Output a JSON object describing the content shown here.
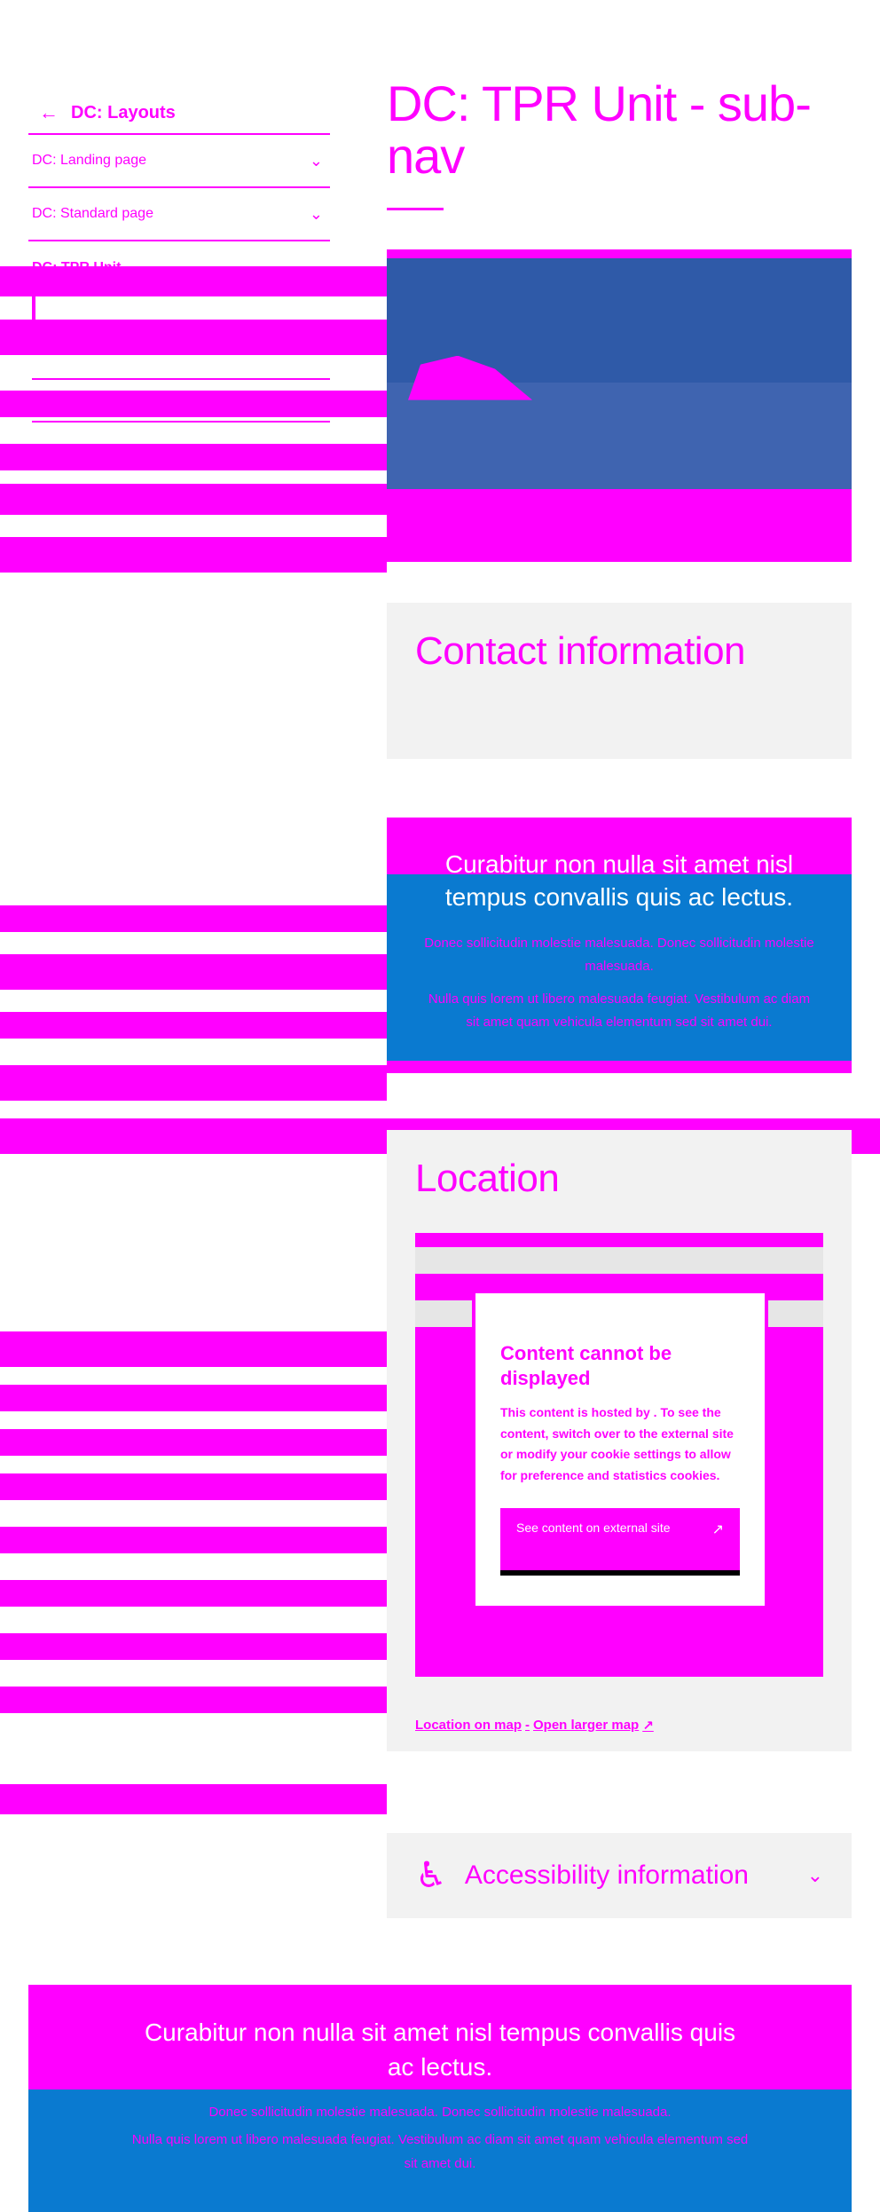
{
  "sidebar": {
    "back_label": "DC: Layouts",
    "items": [
      {
        "label": "DC: Landing page",
        "expandable": true
      },
      {
        "label": "DC: Standard page",
        "expandable": true
      },
      {
        "label": "DC: TPR Unit",
        "expandable": false,
        "active": true
      }
    ]
  },
  "page": {
    "title": "DC: TPR Unit - sub-nav"
  },
  "contact": {
    "title": "Contact information"
  },
  "promo": {
    "lead": "Curabitur non nulla sit amet nisl tempus convallis quis ac lectus.",
    "paragraph_1": "Donec sollicitudin molestie malesuada. Donec sollicitudin molestie malesuada.",
    "paragraph_2": "Nulla quis lorem ut libero malesuada feugiat. Vestibulum ac diam sit amet quam vehicula elementum sed sit amet dui."
  },
  "location": {
    "title": "Location",
    "notice_title": "Content cannot be displayed",
    "notice_text": "This content is hosted by . To see the content, switch over to the external site or modify your cookie settings to allow for preference and statistics cookies.",
    "button_label": "See content on external site",
    "link_map": "Location on map",
    "link_separator": "-",
    "link_larger": "Open larger map"
  },
  "accessibility": {
    "title": "Accessibility information"
  },
  "footer_promo": {
    "lead": "Curabitur non nulla sit amet nisl tempus convallis quis ac lectus.",
    "paragraph_1": "Donec sollicitudin molestie malesuada. Donec sollicitudin molestie malesuada.",
    "paragraph_2": "Nulla quis lorem ut libero malesuada feugiat. Vestibulum ac diam sit amet quam vehicula elementum sed sit amet dui."
  },
  "colors": {
    "accent": "#ff00ff",
    "blue_band": "#0a7ad0",
    "card_gray": "#f2f2f2"
  }
}
